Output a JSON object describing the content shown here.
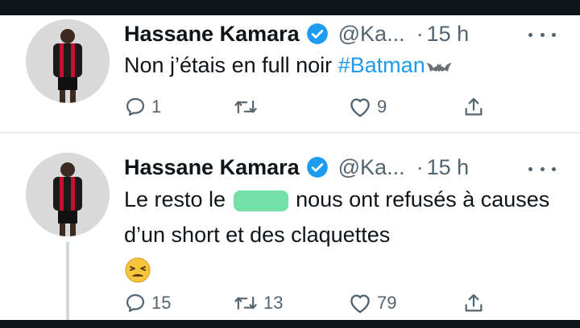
{
  "tweets": [
    {
      "author_name": "Hassane Kamara",
      "handle": "@Ka...",
      "separator": "·",
      "time": "15 h",
      "text_before_tag": "Non j’étais en full noir ",
      "hashtag": "#Batman",
      "emoji_icon": "bat-icon",
      "replies": "1",
      "retweets": "",
      "likes": "9"
    },
    {
      "author_name": "Hassane Kamara",
      "handle": "@Ka...",
      "separator": "·",
      "time": "15 h",
      "text_part1": "Le resto le",
      "text_part2": "nous ont refusés à causes d’un short et des claquettes",
      "emoji_icon": "tired-face-emoji",
      "replies": "15",
      "retweets": "13",
      "likes": "79"
    }
  ],
  "colors": {
    "link": "#1d9bf0",
    "verified": "#1d9bf0",
    "secondary_text": "#536471",
    "redaction": "#74e0a8"
  }
}
